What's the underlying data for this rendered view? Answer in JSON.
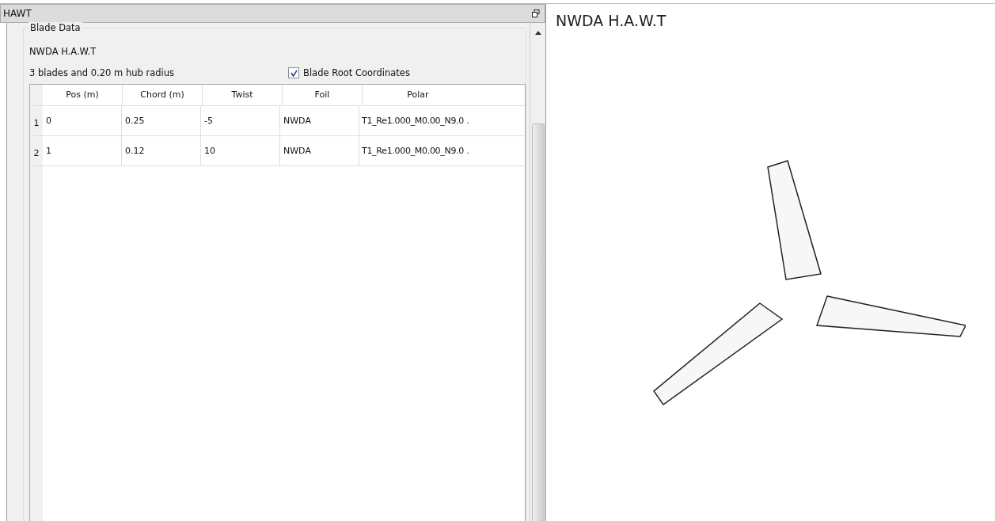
{
  "dock": {
    "title": "HAWT"
  },
  "blade_data": {
    "title": "Blade Data",
    "name": "NWDA H.A.W.T",
    "summary": "3 blades and 0.20 m hub radius",
    "root_coords": {
      "label": "Blade Root Coordinates",
      "checked": true
    }
  },
  "table": {
    "columns": [
      "Pos (m)",
      "Chord (m)",
      "Twist",
      "Foil",
      "Polar"
    ],
    "rows": [
      {
        "index": "1",
        "cells": [
          "0",
          "0.25",
          "-5",
          "NWDA",
          "T1_Re1.000_M0.00_N9.0 ."
        ]
      },
      {
        "index": "2",
        "cells": [
          "1",
          "0.12",
          "10",
          "NWDA",
          "T1_Re1.000_M0.00_N9.0 ."
        ]
      }
    ]
  },
  "view": {
    "title": "NWDA H.A.W.T"
  }
}
